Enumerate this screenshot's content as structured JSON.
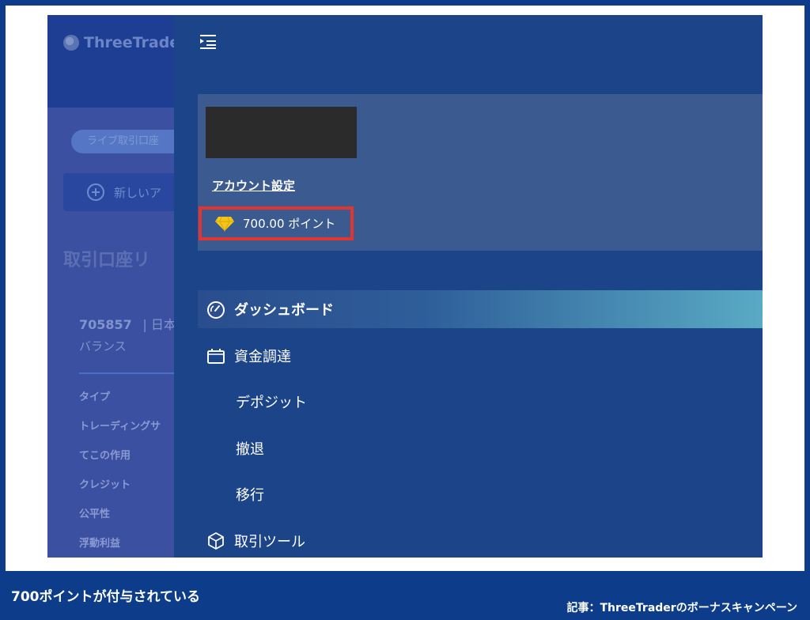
{
  "background_page": {
    "logo_text": "ThreeTrader",
    "chip_label": "ライブ取引口座",
    "new_button_label": "新しいア",
    "section_title": "取引口座リ",
    "account_number": "705857",
    "account_suffix": "| 日本",
    "balance_label": "バランス",
    "rows": [
      "タイプ",
      "トレーディングサ",
      "てこの作用",
      "クレジット",
      "公平性",
      "浮動利益"
    ]
  },
  "drawer": {
    "account_settings_label": "アカウント設定",
    "points_text": "700.00 ポイント",
    "nav": [
      {
        "label": "ダッシュボード",
        "icon": "dashboard-gauge-icon",
        "active": true
      },
      {
        "label": "資金調達",
        "icon": "wallet-icon"
      },
      {
        "label": "デポジット",
        "sub": true
      },
      {
        "label": "撤退",
        "sub": true
      },
      {
        "label": "移行",
        "sub": true
      },
      {
        "label": "取引ツール",
        "icon": "cube-icon"
      }
    ]
  },
  "captions": {
    "left": "700ポイントが付与されている",
    "right": "記事：ThreeTraderのボーナスキャンペーン"
  },
  "colors": {
    "outer_frame": "#0d3d8a",
    "drawer_bg": "#1c4489",
    "card_bg": "#3a5a90",
    "highlight_border": "#e3352f",
    "active_gradient_end": "#59aac4",
    "diamond": "#f2c516"
  }
}
